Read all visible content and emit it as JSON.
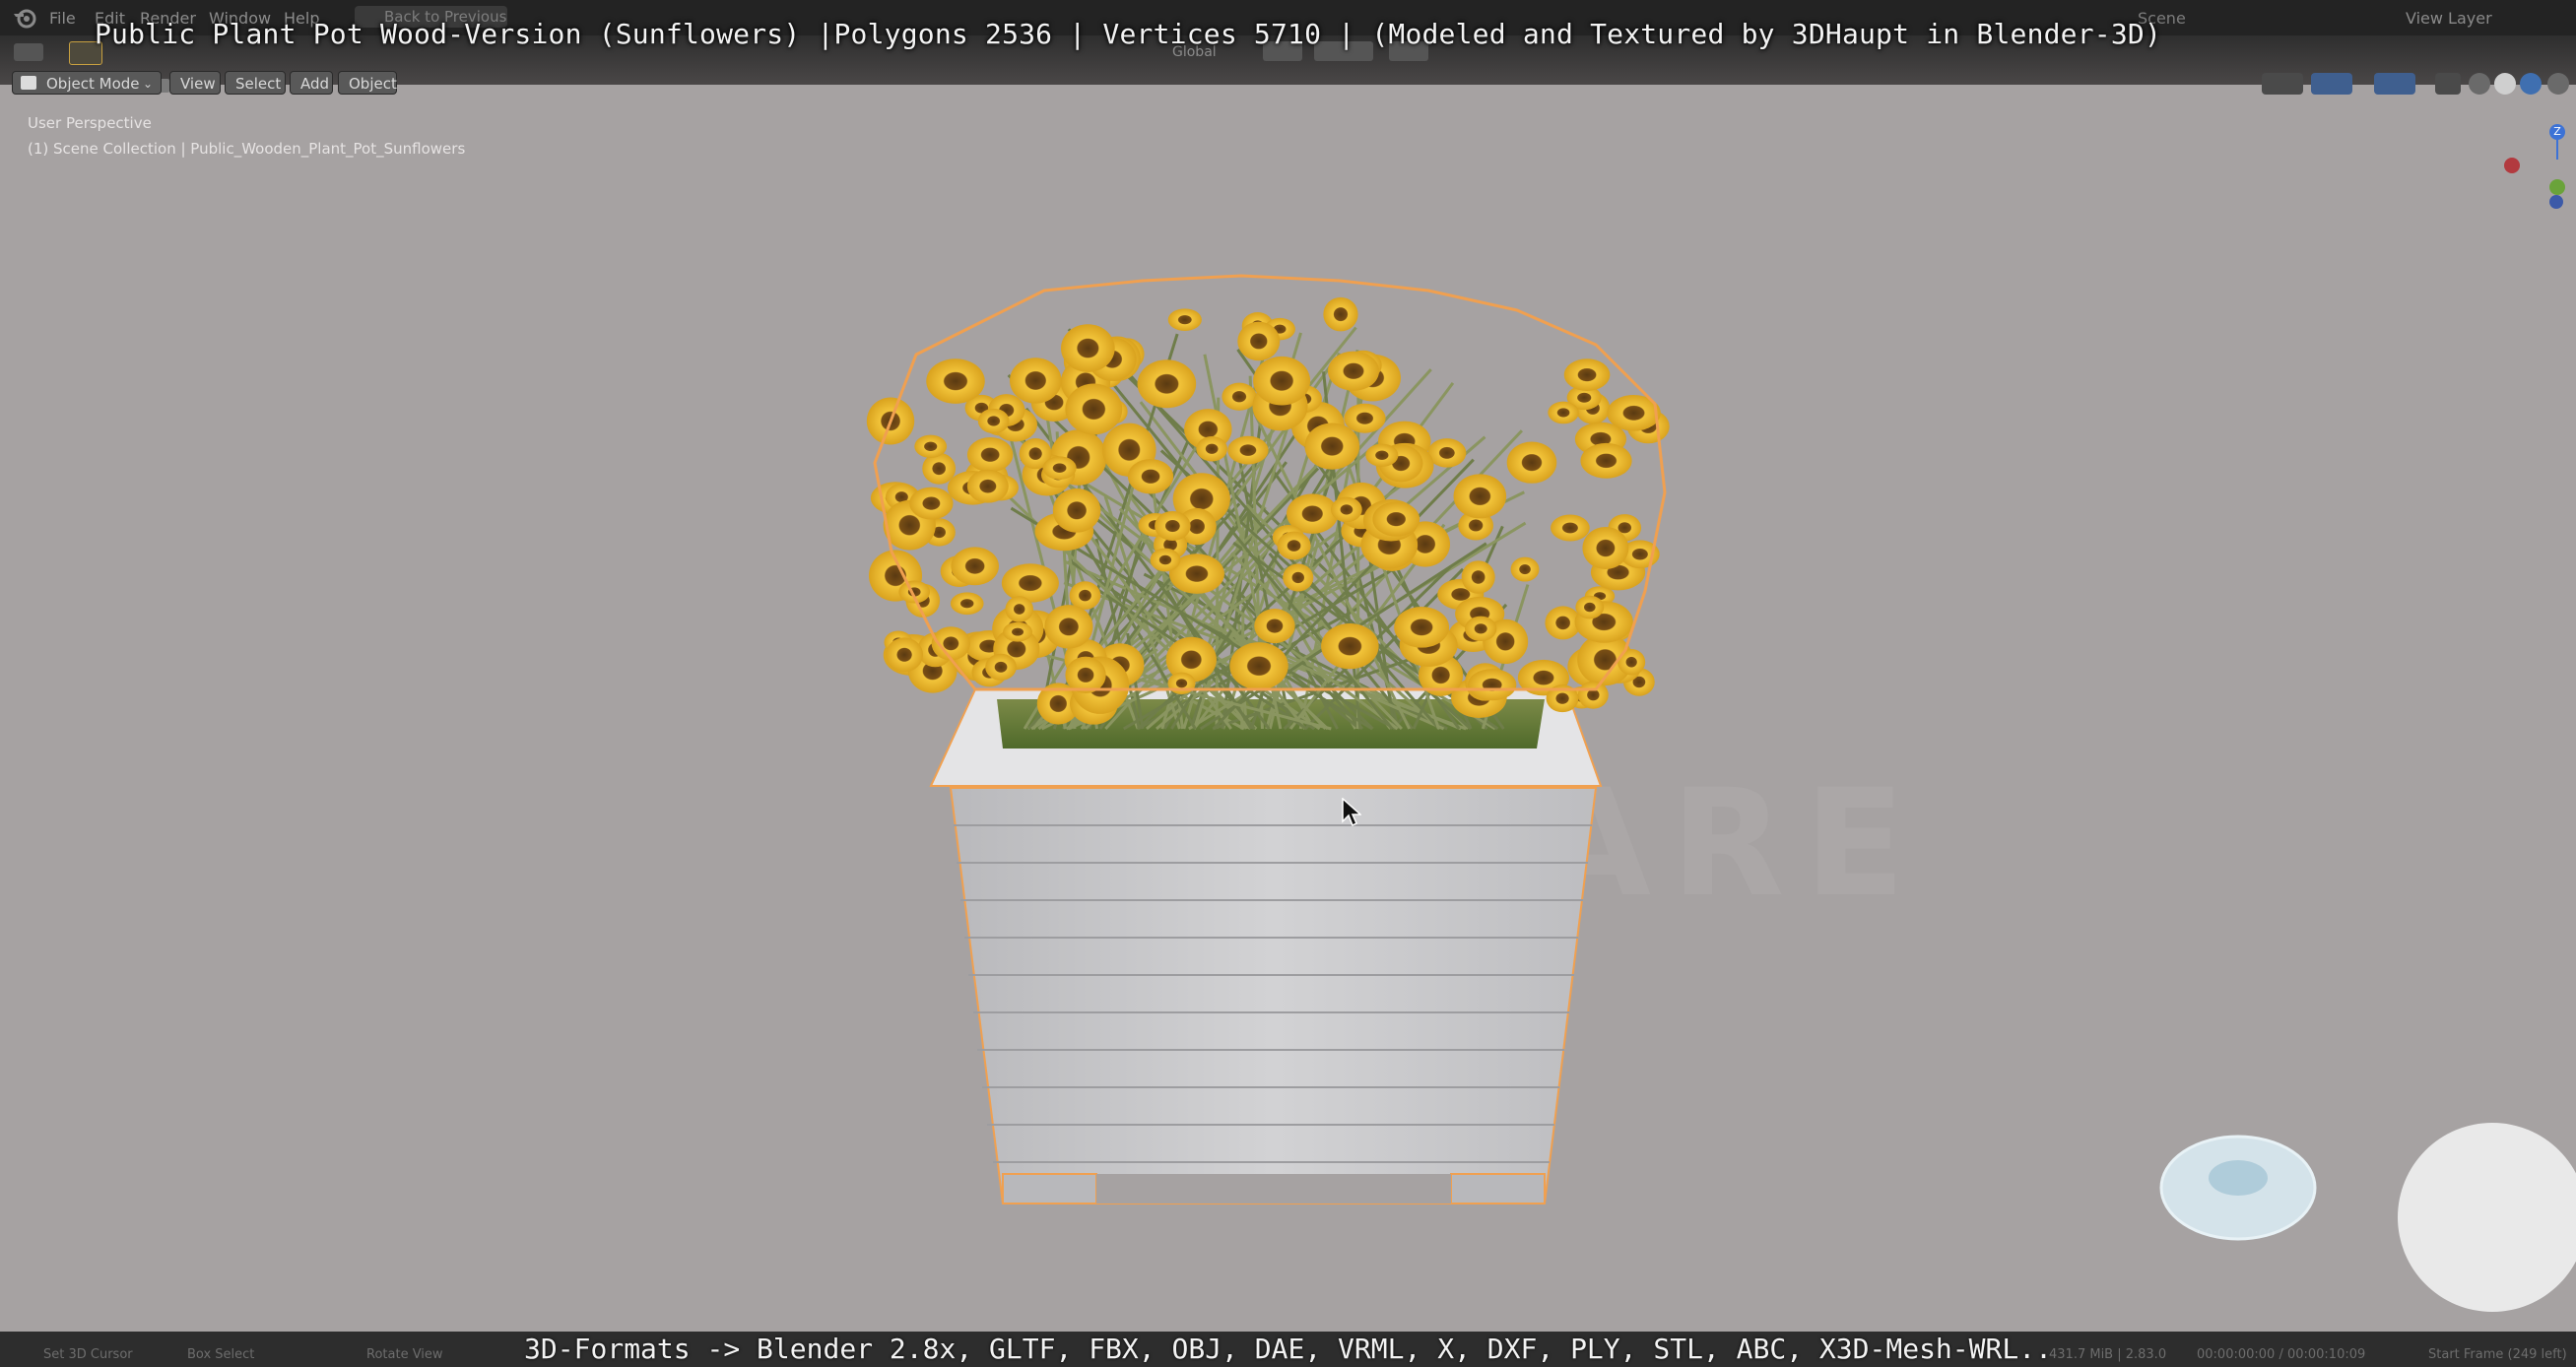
{
  "app": {
    "menu": [
      "File",
      "Edit",
      "Render",
      "Window",
      "Help"
    ],
    "back_button": "Back to Previous",
    "scene_label": "Scene",
    "view_layer_label": "View Layer"
  },
  "overlay": {
    "title": "Public Plant Pot Wood-Version (Sunflowers) |Polygons 2536 | Vertices 5710 | (Modeled and Textured by 3DHaupt in Blender-3D)",
    "bottom": "3D-Formats -> Blender 2.8x, GLTF, FBX, OBJ, DAE, VRML, X, DXF, PLY, STL, ABC, X3D-Mesh-WRL.."
  },
  "header": {
    "mode": "Object Mode",
    "view": "View",
    "select": "Select",
    "add": "Add",
    "object": "Object",
    "transform_orientation": "Global"
  },
  "viewport": {
    "perspective": "User Perspective",
    "collection": "(1) Scene Collection | Public_Wooden_Plant_Pot_Sunflowers",
    "gizmo_axis": "Z"
  },
  "status": {
    "left": "Set 3D Cursor",
    "mid": "Box Select",
    "rotate": "Rotate View",
    "memory": "431.7 MiB | 2.83.0",
    "time": "00:00:00:00 / 00:00:10:09",
    "frames": "Start Frame (249 left)"
  },
  "colors": {
    "viewport_bg": "#a6a2a2",
    "selection_outline": "#f0a050",
    "sunflower_petal": "#e8b82a",
    "pot_wood": "#c9c9cb"
  }
}
